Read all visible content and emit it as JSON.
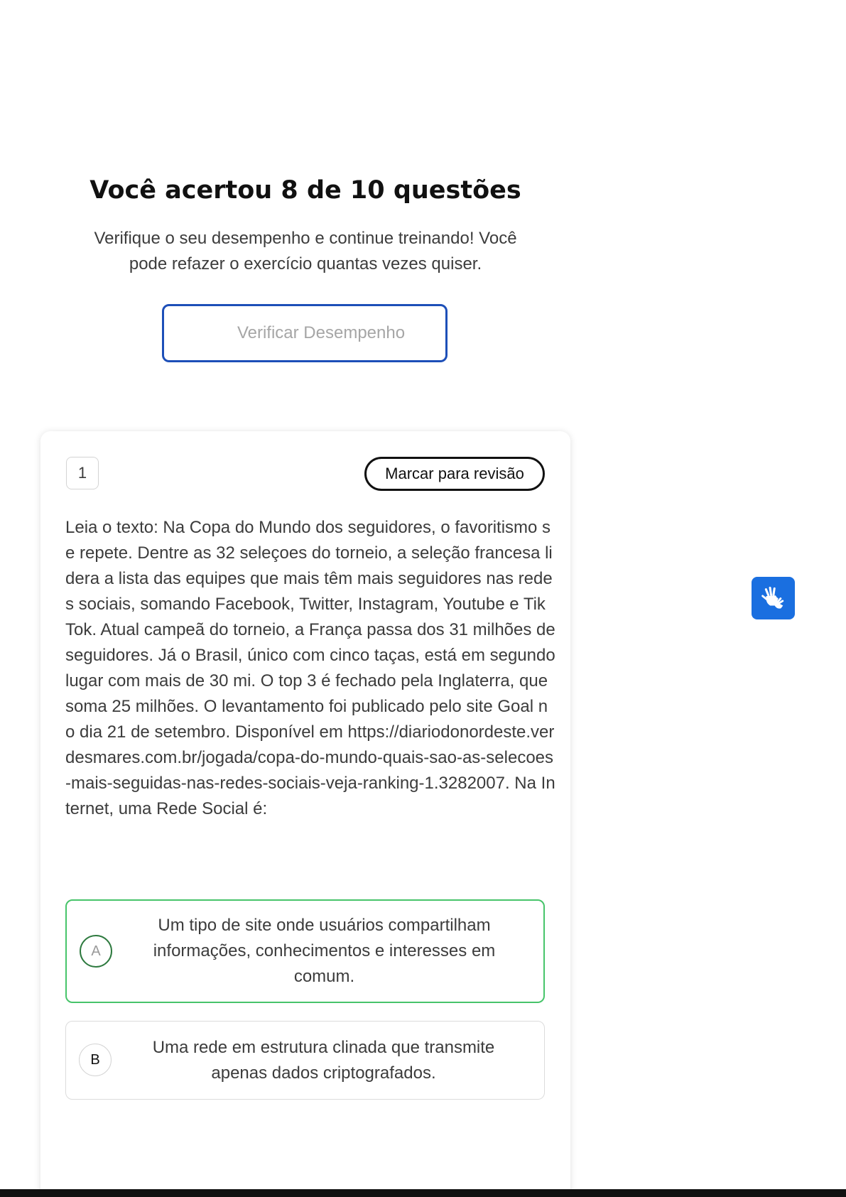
{
  "result": {
    "title": "Você acertou 8 de 10 questões",
    "description": "Verifique o seu desempenho e continue treinando! Você pode refazer o exercício quantas vezes quiser.",
    "verify_button_label": "Verificar Desempenho"
  },
  "question": {
    "number": "1",
    "review_button_label": "Marcar para revisão",
    "text": "Leia o texto: Na Copa do Mundo dos seguidores, o favoritismo se repete. Dentre as 32 seleçoes do torneio, a seleção francesa lidera a lista das equipes que mais têm mais seguidores nas redes sociais, somando Facebook, Twitter, Instagram, Youtube e Tik Tok. Atual campeã do torneio, a França passa dos 31 milhões de seguidores. Já o Brasil, único com cinco taças, está em segundo lugar com mais de 30 mi. O top 3 é fechado pela Inglaterra, que soma 25 milhões. O levantamento foi publicado pelo site Goal no dia 21 de setembro. Disponível em https://diariodonordeste.verdesmares.com.br/jogada/copa-do-mundo-quais-sao-as-selecoes-mais-seguidas-nas-redes-sociais-veja-ranking-1.3282007. Na Internet, uma Rede Social é:",
    "options": [
      {
        "letter": "A",
        "text": "Um tipo de site onde usuários compartilham informações, conhecimentos e interesses em comum.",
        "state": "correct"
      },
      {
        "letter": "B",
        "text": "Uma rede em estrutura clinada que transmite apenas dados criptografados.",
        "state": "default"
      }
    ]
  },
  "accessibility": {
    "libras_icon": "sign-language-hands-icon"
  },
  "colors": {
    "primary_blue": "#1d4fb8",
    "libras_blue": "#1a6fe0",
    "correct_green": "#47c46a",
    "correct_circle": "#2e7a3f"
  }
}
